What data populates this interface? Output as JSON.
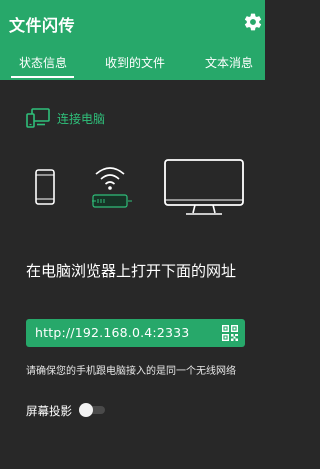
{
  "app": {
    "title": "文件闪传",
    "settings_icon": "gear-icon"
  },
  "tabs": [
    {
      "label": "状态信息",
      "active": true
    },
    {
      "label": "收到的文件",
      "active": false
    },
    {
      "label": "文本消息",
      "active": false
    }
  ],
  "connect": {
    "label": "连接电脑",
    "icon": "monitor-connect-icon"
  },
  "illustration": {
    "icons": [
      "phone-icon",
      "wifi-router-icon",
      "desktop-monitor-icon"
    ]
  },
  "main": {
    "headline": "在电脑浏览器上打开下面的网址",
    "url": "http://192.168.0.4:2333",
    "qr_icon": "qr-code-icon",
    "hint": "请确保您的手机跟电脑接入的是同一个无线网络"
  },
  "projection": {
    "label": "屏幕投影",
    "enabled": false
  },
  "colors": {
    "accent": "#27a86a",
    "accent_text": "#2fbf7a",
    "background": "#282828"
  }
}
